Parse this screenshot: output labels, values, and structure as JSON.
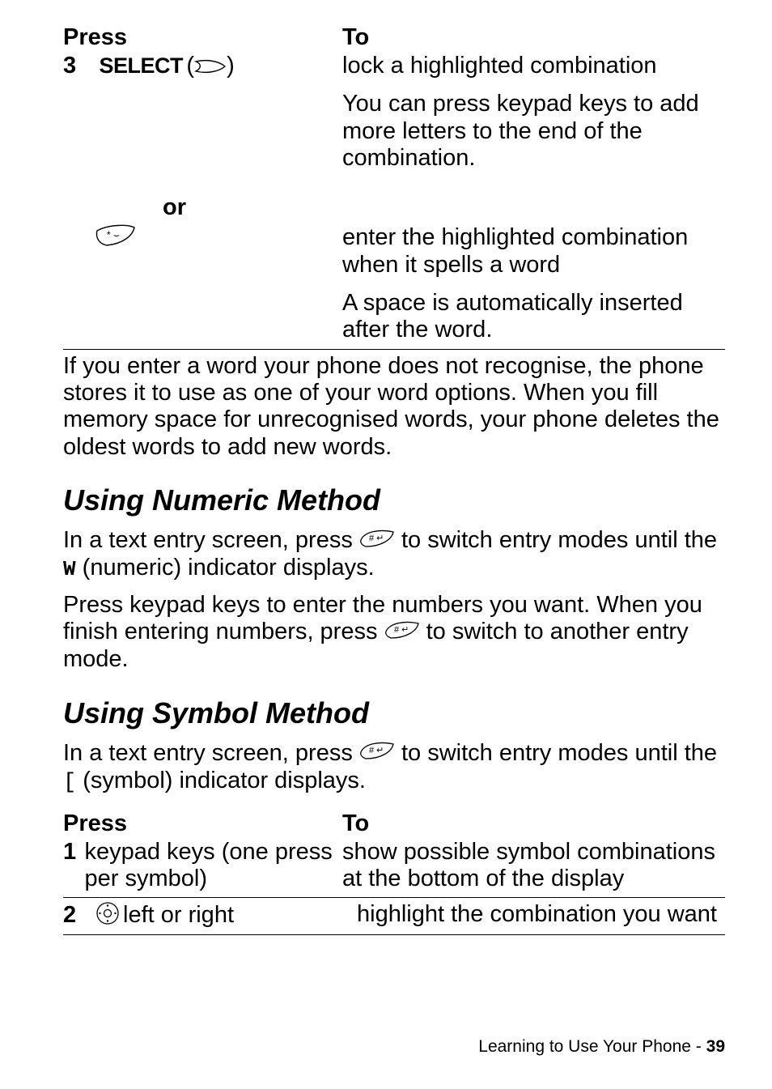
{
  "table1": {
    "head_left": "Press",
    "head_right": "To",
    "row1": {
      "num": "3",
      "label": "SELECT",
      "right1": "lock a highlighted combination",
      "right2": "You can press keypad keys to add more letters to the end of the combination."
    },
    "or": "or",
    "row2": {
      "right1": "enter the highlighted combination when it spells a word",
      "right2": "A space is automatically inserted after the word."
    }
  },
  "para1": "If you enter a word your phone does not recognise, the phone stores it to use as one of your word options. When you fill memory space for unrecognised words, your phone deletes the oldest words to add new words.",
  "heading1": "Using Numeric Method",
  "numeric": {
    "p1a": "In a text entry screen, press ",
    "p1b": " to switch entry modes until the ",
    "p1c": " (numeric) indicator displays.",
    "code123": "W",
    "p2a": "Press keypad keys to enter the numbers you want. When you finish entering numbers, press ",
    "p2b": " to switch to another entry mode."
  },
  "heading2": "Using Symbol Method",
  "symbol": {
    "p1a": "In a text entry screen, press ",
    "p1b": " to switch entry modes until the ",
    "p1c": " (symbol) indicator displays.",
    "at": "["
  },
  "table2": {
    "head_left": "Press",
    "head_right": "To",
    "row1": {
      "num": "1",
      "left": "keypad keys (one press per symbol)",
      "right": "show possible symbol combinations at the bottom of the display"
    },
    "row2": {
      "num": "2",
      "left": " left or right",
      "right": "highlight the combination you want"
    }
  },
  "footer": {
    "text": "Learning to Use Your Phone - ",
    "page": "39"
  }
}
